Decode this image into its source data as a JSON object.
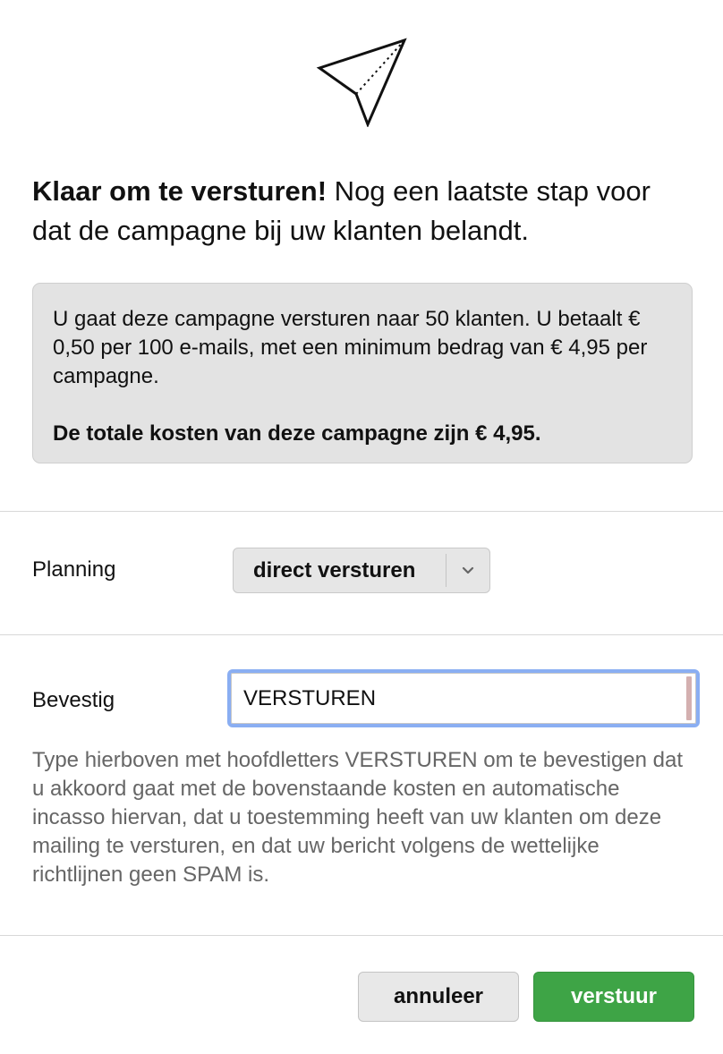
{
  "header": {
    "icon": "paper-plane-icon",
    "title_strong": "Klaar om te versturen!",
    "title_rest": " Nog een laatste stap voor dat de campagne bij uw klanten belandt."
  },
  "cost_box": {
    "description": "U gaat deze campagne versturen naar 50 klanten. U betaalt € 0,50 per 100 e-mails, met een minimum bedrag van € 4,95 per campagne.",
    "total": "De totale kosten van deze campagne zijn € 4,95."
  },
  "planning": {
    "label": "Planning",
    "selected": "direct versturen",
    "arrow_icon": "chevron-down-icon"
  },
  "confirm": {
    "label": "Bevestig",
    "value": "VERSTUREN",
    "help": "Type hierboven met hoofdletters VERSTUREN om te bevestigen dat u akkoord gaat met de bovenstaande kosten en automatische incasso hiervan, dat u toestemming heeft van uw klanten om deze mailing te versturen, en dat uw bericht volgens de wettelijke richtlijnen geen SPAM is."
  },
  "actions": {
    "cancel_label": "annuleer",
    "send_label": "verstuur"
  },
  "colors": {
    "send_button": "#3ea446",
    "input_focus_border": "#8aaef2",
    "cost_box_background": "#e3e3e3"
  }
}
